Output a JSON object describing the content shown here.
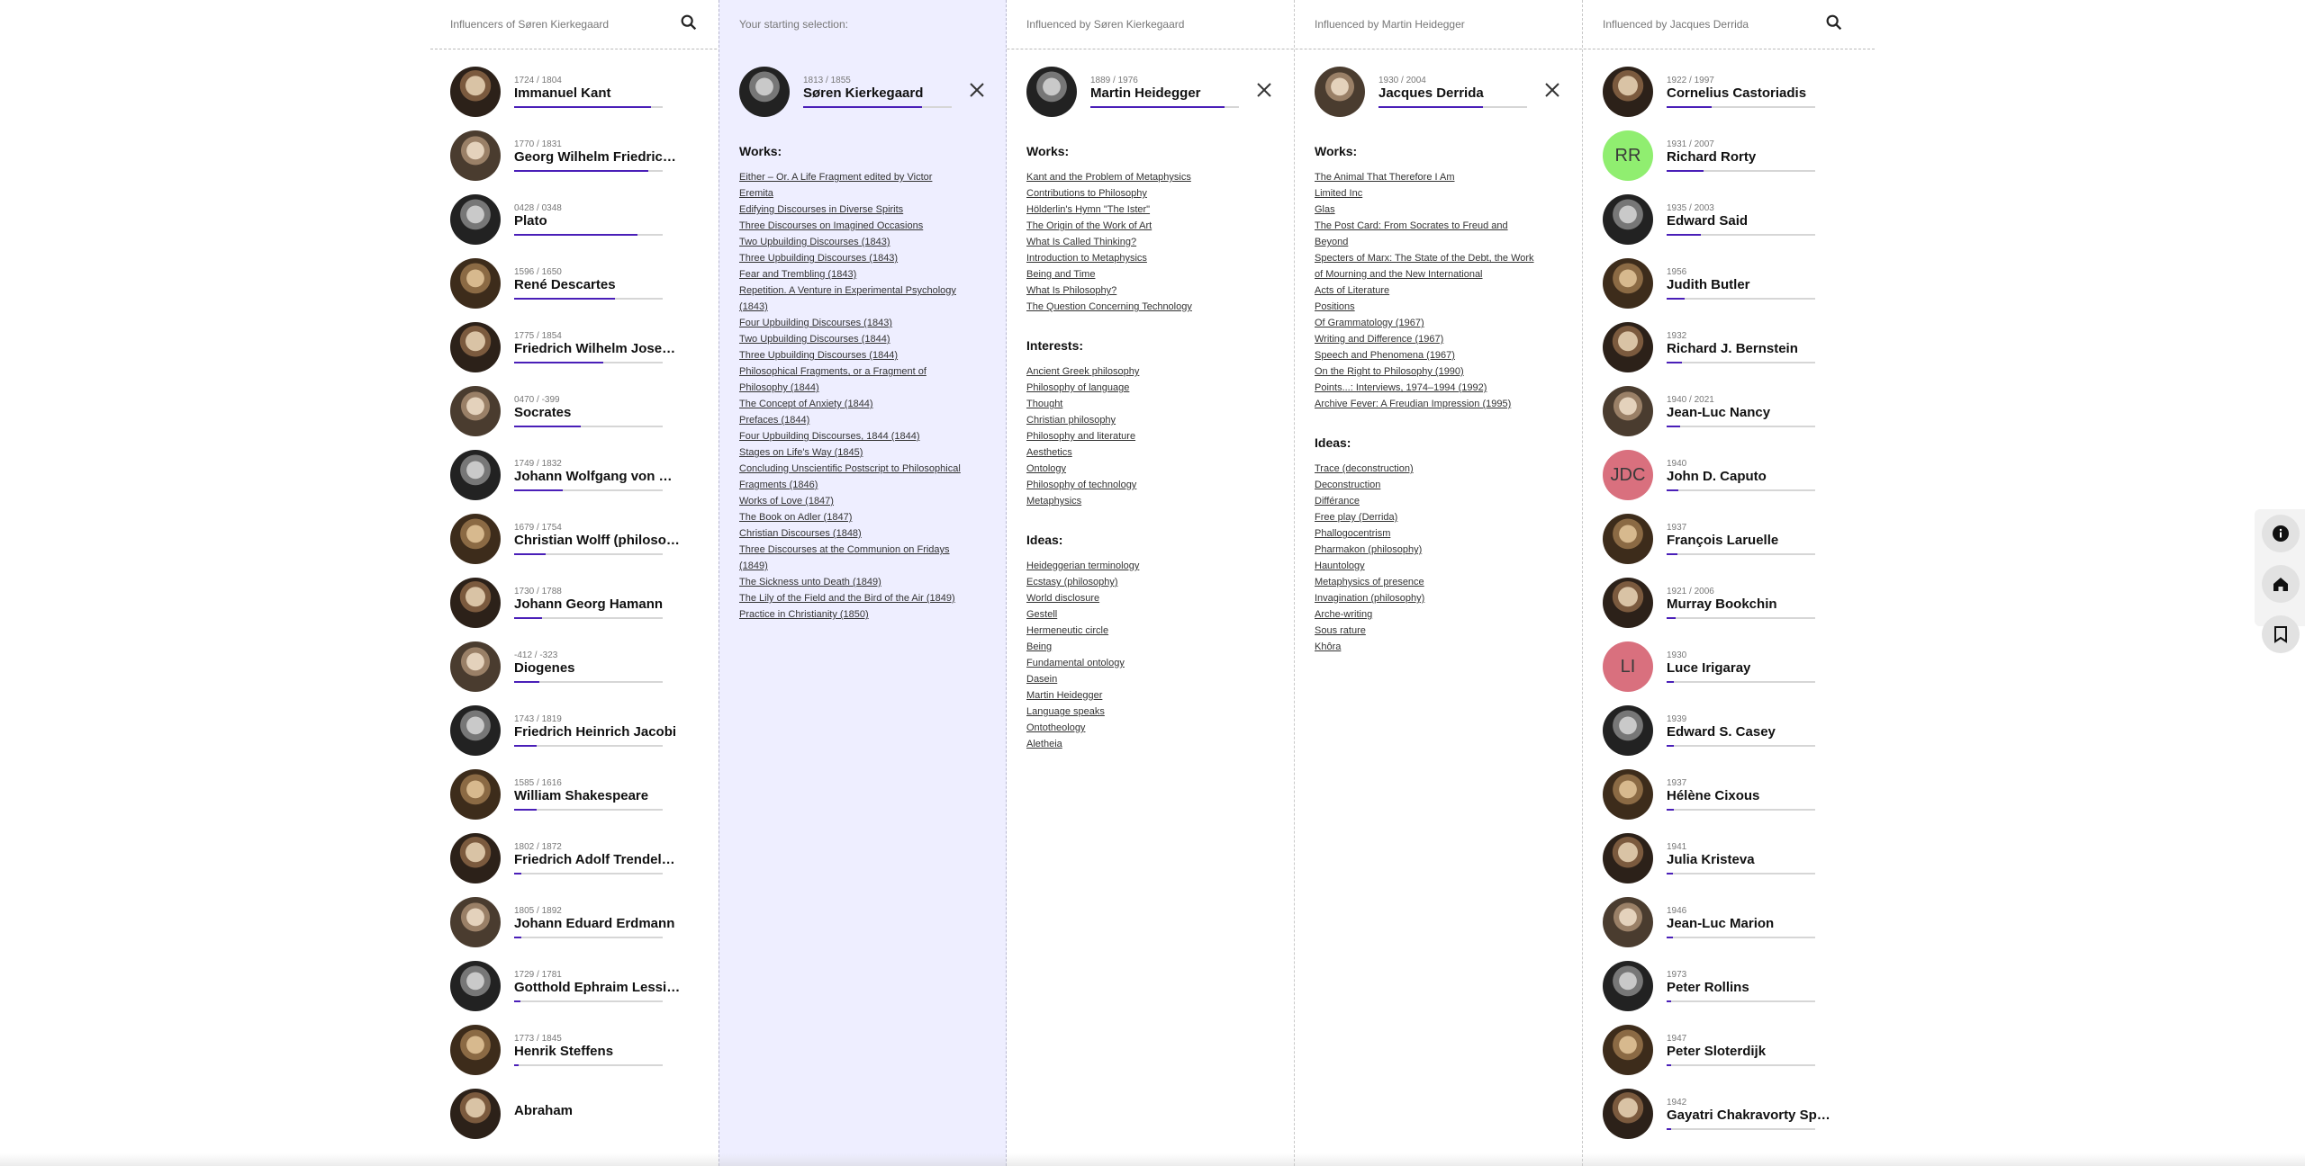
{
  "columns": {
    "influencers": {
      "header": "Influencers of Søren Kierkegaard",
      "people": [
        {
          "dates": "1724 / 1804",
          "name": "Immanuel Kant",
          "score": 0.92
        },
        {
          "dates": "1770 / 1831",
          "name": "Georg Wilhelm Friedrich Hegel",
          "score": 0.9
        },
        {
          "dates": "0428 / 0348",
          "name": "Plato",
          "score": 0.83
        },
        {
          "dates": "1596 / 1650",
          "name": "René Descartes",
          "score": 0.68
        },
        {
          "dates": "1775 / 1854",
          "name": "Friedrich Wilhelm Joseph Schelling",
          "score": 0.6
        },
        {
          "dates": "0470 / -399",
          "name": "Socrates",
          "score": 0.45
        },
        {
          "dates": "1749 / 1832",
          "name": "Johann Wolfgang von Goethe",
          "score": 0.33
        },
        {
          "dates": "1679 / 1754",
          "name": "Christian Wolff (philosopher)",
          "score": 0.21
        },
        {
          "dates": "1730 / 1788",
          "name": "Johann Georg Hamann",
          "score": 0.19
        },
        {
          "dates": "-412 / -323",
          "name": "Diogenes",
          "score": 0.17
        },
        {
          "dates": "1743 / 1819",
          "name": "Friedrich Heinrich Jacobi",
          "score": 0.15
        },
        {
          "dates": "1585 / 1616",
          "name": "William Shakespeare",
          "score": 0.15
        },
        {
          "dates": "1802 / 1872",
          "name": "Friedrich Adolf Trendelenburg",
          "score": 0.05
        },
        {
          "dates": "1805 / 1892",
          "name": "Johann Eduard Erdmann",
          "score": 0.05
        },
        {
          "dates": "1729 / 1781",
          "name": "Gotthold Ephraim Lessing",
          "score": 0.04
        },
        {
          "dates": "1773 / 1845",
          "name": "Henrik Steffens",
          "score": 0.03
        },
        {
          "dates": "",
          "name": "Abraham",
          "score": 0
        }
      ]
    },
    "starting": {
      "header": "Your starting selection:",
      "person": {
        "dates": "1813 / 1855",
        "name": "Søren Kierkegaard",
        "score": 0.8
      },
      "works_title": "Works:",
      "works": [
        "Either – Or. A Life Fragment edited by Victor Eremita",
        "Edifying Discourses in Diverse Spirits",
        "Three Discourses on Imagined Occasions",
        "Two Upbuilding Discourses (1843)",
        "Three Upbuilding Discourses (1843)",
        "Fear and Trembling (1843)",
        "Repetition. A Venture in Experimental Psychology (1843)",
        "Four Upbuilding Discourses (1843)",
        "Two Upbuilding Discourses (1844)",
        "Three Upbuilding Discourses (1844)",
        "Philosophical Fragments, or a Fragment of Philosophy (1844)",
        "The Concept of Anxiety (1844)",
        "Prefaces (1844)",
        "Four Upbuilding Discourses, 1844 (1844)",
        "Stages on Life's Way (1845)",
        "Concluding Unscientific Postscript to Philosophical Fragments (1846)",
        "Works of Love (1847)",
        "The Book on Adler (1847)",
        "Christian Discourses (1848)",
        "Three Discourses at the Communion on Fridays (1849)",
        "The Sickness unto Death (1849)",
        "The Lily of the Field and the Bird of the Air (1849)",
        "Practice in Christianity (1850)"
      ]
    },
    "heidegger": {
      "header": "Influenced by Søren Kierkegaard",
      "person": {
        "dates": "1889 / 1976",
        "name": "Martin Heidegger",
        "score": 0.9
      },
      "works_title": "Works:",
      "works": [
        "Kant and the Problem of Metaphysics",
        "Contributions to Philosophy",
        "Hölderlin's Hymn \"The Ister\"",
        "The Origin of the Work of Art",
        "What Is Called Thinking?",
        "Introduction to Metaphysics",
        "Being and Time",
        "What Is Philosophy?",
        "The Question Concerning Technology"
      ],
      "interests_title": "Interests:",
      "interests": [
        "Ancient Greek philosophy",
        "Philosophy of language",
        "Thought",
        "Christian philosophy",
        "Philosophy and literature",
        "Aesthetics",
        "Ontology",
        "Philosophy of technology",
        "Metaphysics"
      ],
      "ideas_title": "Ideas:",
      "ideas": [
        "Heideggerian terminology",
        "Ecstasy (philosophy)",
        "World disclosure",
        "Gestell",
        "Hermeneutic circle",
        "Being",
        "Fundamental ontology",
        "Dasein",
        "Martin Heidegger",
        "Language speaks",
        "Ontotheology",
        "Aletheia"
      ]
    },
    "derrida": {
      "header": "Influenced by Martin Heidegger",
      "person": {
        "dates": "1930 / 2004",
        "name": "Jacques Derrida",
        "score": 0.7
      },
      "works_title": "Works:",
      "works": [
        "The Animal That Therefore I Am",
        "Limited Inc",
        "Glas",
        "The Post Card: From Socrates to Freud and Beyond",
        "Specters of Marx: The State of the Debt, the Work of Mourning and the New International",
        "Acts of Literature",
        "Positions",
        "Of Grammatology (1967)",
        "Writing and Difference (1967)",
        "Speech and Phenomena (1967)",
        "On the Right to Philosophy (1990)",
        "Points...: Interviews, 1974–1994 (1992)",
        "Archive Fever: A Freudian Impression (1995)"
      ],
      "ideas_title": "Ideas:",
      "ideas": [
        "Trace (deconstruction)",
        "Deconstruction",
        "Différance",
        "Free play (Derrida)",
        "Phallogocentrism",
        "Pharmakon (philosophy)",
        "Hauntology",
        "Metaphysics of presence",
        "Invagination (philosophy)",
        "Arche-writing",
        "Sous rature",
        "Khôra"
      ]
    },
    "influenced_derrida": {
      "header": "Influenced by Jacques Derrida",
      "people": [
        {
          "dates": "1922 / 1997",
          "name": "Cornelius Castoriadis",
          "score": 0.3,
          "initials": ""
        },
        {
          "dates": "1931 / 2007",
          "name": "Richard Rorty",
          "score": 0.25,
          "initials": "RR",
          "color": "#90ee70"
        },
        {
          "dates": "1935 / 2003",
          "name": "Edward Said",
          "score": 0.23,
          "initials": ""
        },
        {
          "dates": "1956",
          "name": "Judith Butler",
          "score": 0.12,
          "initials": ""
        },
        {
          "dates": "1932",
          "name": "Richard J. Bernstein",
          "score": 0.1,
          "initials": ""
        },
        {
          "dates": "1940 / 2021",
          "name": "Jean-Luc Nancy",
          "score": 0.09,
          "initials": ""
        },
        {
          "dates": "1940",
          "name": "John D. Caputo",
          "score": 0.08,
          "initials": "JDC",
          "color": "#d9707e"
        },
        {
          "dates": "1937",
          "name": "François Laruelle",
          "score": 0.07,
          "initials": ""
        },
        {
          "dates": "1921 / 2006",
          "name": "Murray Bookchin",
          "score": 0.06,
          "initials": ""
        },
        {
          "dates": "1930",
          "name": "Luce Irigaray",
          "score": 0.05,
          "initials": "LI",
          "color": "#d9707e"
        },
        {
          "dates": "1939",
          "name": "Edward S. Casey",
          "score": 0.05,
          "initials": ""
        },
        {
          "dates": "1937",
          "name": "Hélène Cixous",
          "score": 0.05,
          "initials": ""
        },
        {
          "dates": "1941",
          "name": "Julia Kristeva",
          "score": 0.04,
          "initials": ""
        },
        {
          "dates": "1946",
          "name": "Jean-Luc Marion",
          "score": 0.04,
          "initials": ""
        },
        {
          "dates": "1973",
          "name": "Peter Rollins",
          "score": 0.03,
          "initials": ""
        },
        {
          "dates": "1947",
          "name": "Peter Sloterdijk",
          "score": 0.03,
          "initials": ""
        },
        {
          "dates": "1942",
          "name": "Gayatri Chakravorty Spivak",
          "score": 0.03,
          "initials": ""
        }
      ]
    }
  },
  "side_buttons": [
    {
      "icon": "info-icon"
    },
    {
      "icon": "home-icon"
    },
    {
      "icon": "bookmark-icon"
    }
  ],
  "colors": {
    "accent": "#4a1fb8",
    "selection_bg": "#eeeeff"
  }
}
